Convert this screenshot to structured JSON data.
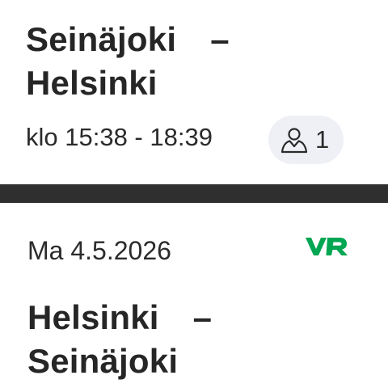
{
  "ticket1": {
    "from": "Seinäjoki",
    "separator": "–",
    "to": "Helsinki",
    "time": "klo 15:38 - 18:39",
    "passengers": "1",
    "passenger_icon": "person-outline-icon"
  },
  "ticket2": {
    "date": "Ma 4.5.2026",
    "brand_logo": "vr-logo",
    "brand_color": "#00a651",
    "from": "Helsinki",
    "separator": "–",
    "to": "Seinäjoki"
  },
  "colors": {
    "divider": "#2f2f2f",
    "badge_background": "#eef0f6",
    "text": "#262626"
  }
}
